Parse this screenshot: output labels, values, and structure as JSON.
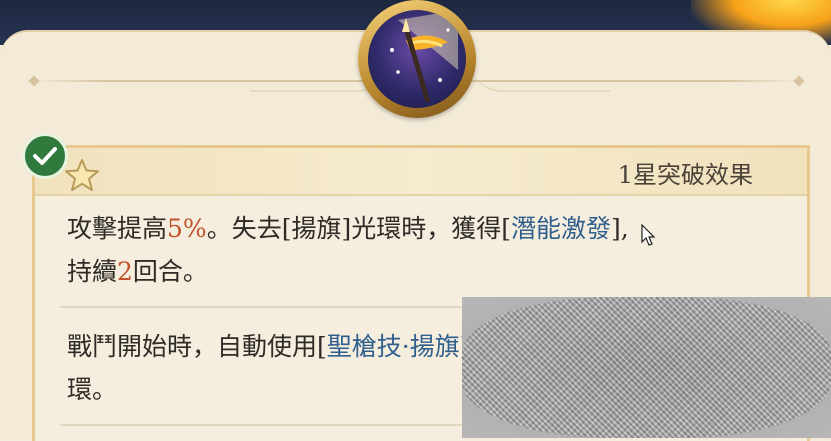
{
  "header": {
    "skill_icon": "spear-flag-icon"
  },
  "panel": {
    "title": "1星突破效果",
    "check_icon": "check-icon",
    "star_icon": "star-icon"
  },
  "effects": [
    {
      "line1": [
        {
          "t": "攻擊提高",
          "c": "normal"
        },
        {
          "t": "5%",
          "c": "num"
        },
        {
          "t": "。失去[揚旗]光環時，獲得[",
          "c": "normal"
        },
        {
          "t": "潛能激發",
          "c": "skill"
        },
        {
          "t": "],",
          "c": "normal"
        }
      ],
      "line2": [
        {
          "t": "持續",
          "c": "normal"
        },
        {
          "t": "2",
          "c": "num"
        },
        {
          "t": "回合。",
          "c": "normal"
        }
      ]
    },
    {
      "line1": [
        {
          "t": "戰鬥開始時，自動使用[",
          "c": "normal"
        },
        {
          "t": "聖槍技·揚旗",
          "c": "skill"
        },
        {
          "t": "]",
          "c": "normal"
        }
      ],
      "line2": [
        {
          "t": "環。",
          "c": "normal"
        }
      ]
    }
  ],
  "colors": {
    "highlight_number": "#c0532c",
    "highlight_skill": "#2f5f8c",
    "badge_green": "#2f7a3c"
  }
}
